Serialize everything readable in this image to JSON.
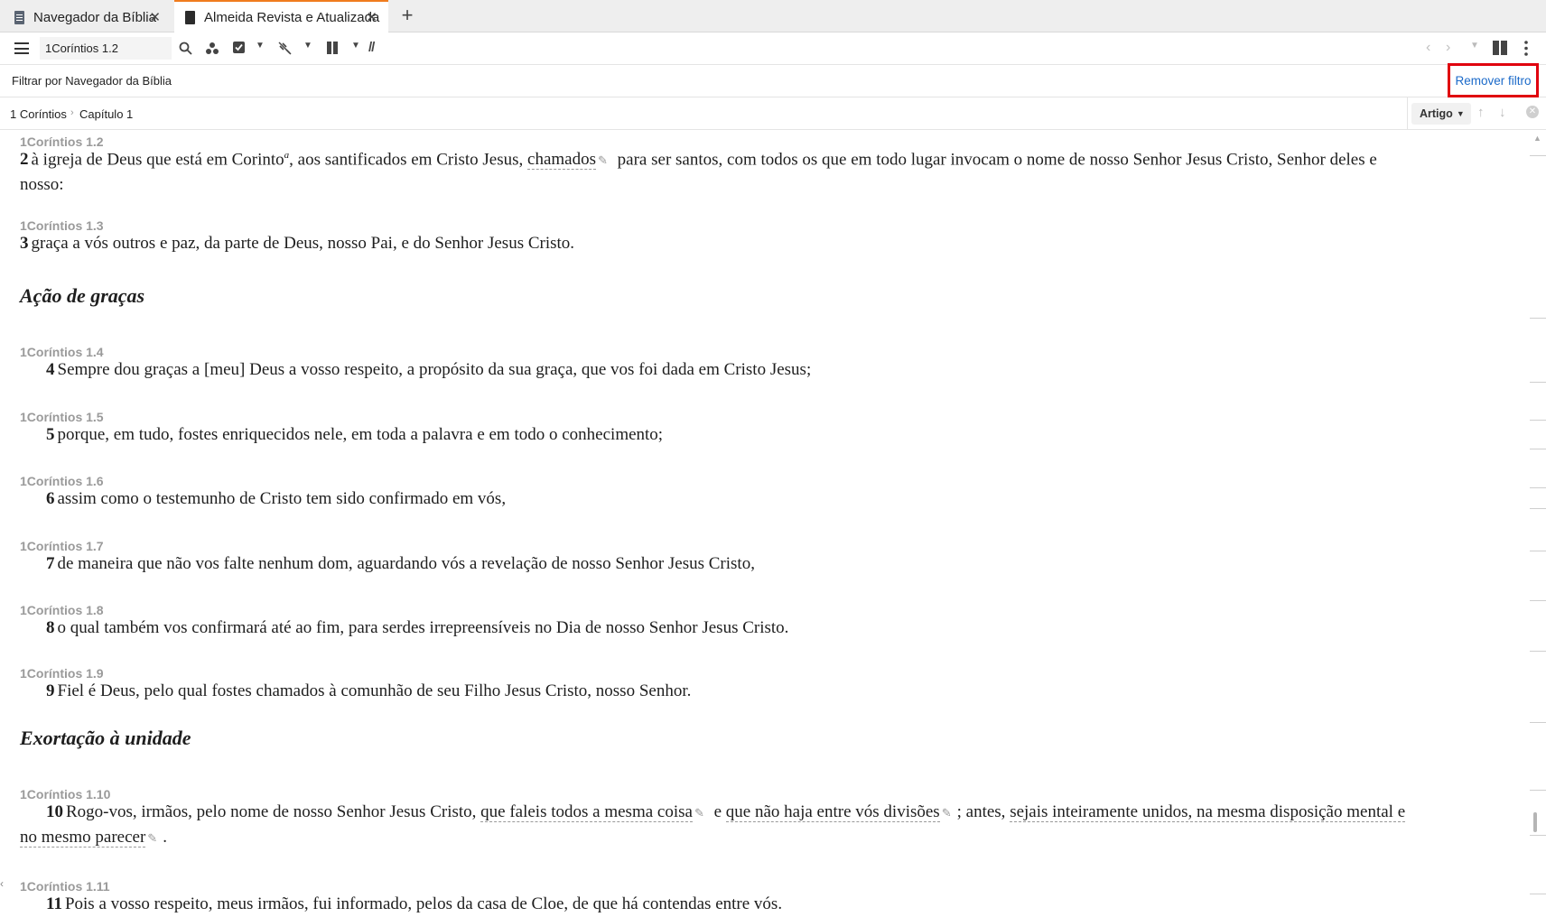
{
  "tabs": [
    {
      "label": "Navegador da Bíblia",
      "close": "✕"
    },
    {
      "label": "Almeida Revista e Atualizada",
      "close": "✕"
    }
  ],
  "tab_add": "+",
  "toolbar": {
    "reference_value": "1Coríntios 1.2",
    "parallel_label": "//",
    "icons": [
      "menu-icon",
      "search-icon",
      "cluster-icon",
      "checklist-icon",
      "link-off-icon",
      "columns-icon",
      "back-icon",
      "forward-icon",
      "layout-icon",
      "more-icon"
    ]
  },
  "filter": {
    "text": "Filtrar por Navegador da Bíblia",
    "remove_label": "Remover filtro"
  },
  "breadcrumb": {
    "book": "1 Coríntios",
    "chapter": "Capítulo 1",
    "view_mode": "Artigo"
  },
  "verses": [
    {
      "ref": "1Coríntios 1.2",
      "num": "2",
      "lines": [
        "à igreja de Deus que está em Corinto",
        ", aos santificados em Cristo Jesus, ",
        "chamados",
        " para ser santos, com todos os que em todo lugar invocam o nome de nosso Senhor Jesus Cristo, Senhor deles e",
        "nosso:"
      ],
      "footnote": "a"
    },
    {
      "ref": "1Coríntios 1.3",
      "num": "3",
      "text": "graça a vós outros e paz, da parte de Deus, nosso Pai, e do Senhor Jesus Cristo."
    },
    {
      "heading": "Ação de graças"
    },
    {
      "ref": "1Coríntios 1.4",
      "num": "4",
      "text": "Sempre dou graças a [meu] Deus a vosso respeito, a propósito da sua graça, que vos foi dada em Cristo Jesus;"
    },
    {
      "ref": "1Coríntios 1.5",
      "num": "5",
      "text": "porque, em tudo, fostes enriquecidos nele, em toda a palavra e em todo o conhecimento;"
    },
    {
      "ref": "1Coríntios 1.6",
      "num": "6",
      "text": "assim como o testemunho de Cristo tem sido confirmado em vós,"
    },
    {
      "ref": "1Coríntios 1.7",
      "num": "7",
      "text": "de maneira que não vos falte nenhum dom, aguardando vós a revelação de nosso Senhor Jesus Cristo,"
    },
    {
      "ref": "1Coríntios 1.8",
      "num": "8",
      "text": "o qual também vos confirmará até ao fim, para serdes irrepreensíveis no Dia de nosso Senhor Jesus Cristo."
    },
    {
      "ref": "1Coríntios 1.9",
      "num": "9",
      "text": "Fiel é Deus, pelo qual fostes chamados à comunhão de seu Filho Jesus Cristo, nosso Senhor."
    },
    {
      "heading": "Exortação à unidade"
    },
    {
      "ref": "1Coríntios 1.10",
      "num": "10",
      "parts": [
        "Rogo-vos, irmãos, pelo nome de nosso Senhor Jesus Cristo, ",
        "que faleis todos a mesma coisa",
        " e ",
        "que não haja entre vós divisões",
        "; antes, ",
        "sejais inteiramente unidos, na mesma disposição mental e",
        "no mesmo parecer",
        "."
      ]
    },
    {
      "ref": "1Coríntios 1.11",
      "num": "11",
      "text": "Pois a vosso respeito, meus irmãos, fui informado, pelos da casa de Cloe, de que há contendas entre vós."
    }
  ]
}
